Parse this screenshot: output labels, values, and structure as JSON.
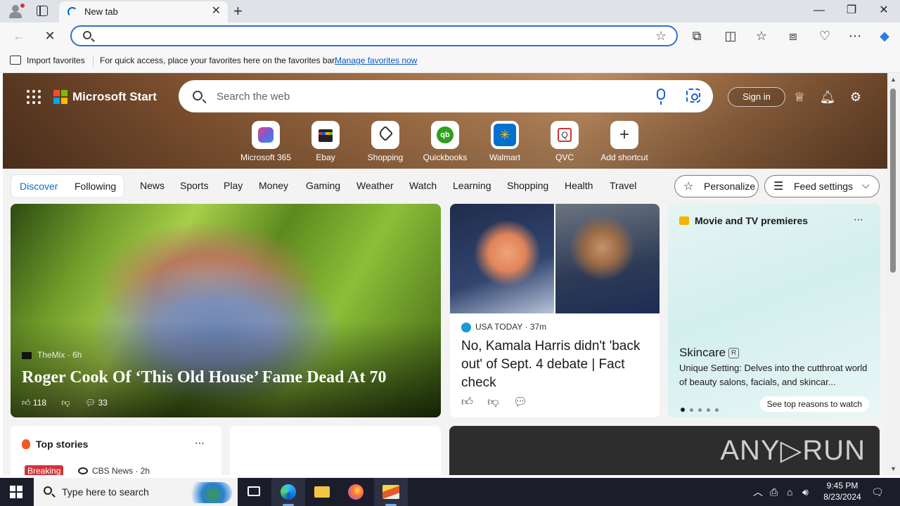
{
  "browser": {
    "tab_title": "New tab",
    "address_value": "",
    "favorites_bar": {
      "import_label": "Import favorites",
      "hint": "For quick access, place your favorites here on the favorites bar.",
      "manage_link": "Manage favorites now"
    }
  },
  "start": {
    "brand": "Microsoft Start",
    "search_placeholder": "Search the web",
    "sign_in": "Sign in",
    "shortcuts": [
      {
        "label": "Microsoft 365",
        "icon": "microsoft365-icon"
      },
      {
        "label": "Ebay",
        "icon": "ebay-icon"
      },
      {
        "label": "Shopping",
        "icon": "tag-icon"
      },
      {
        "label": "Quickbooks",
        "icon": "quickbooks-icon"
      },
      {
        "label": "Walmart",
        "icon": "walmart-icon"
      },
      {
        "label": "QVC",
        "icon": "qvc-icon"
      },
      {
        "label": "Add shortcut",
        "icon": "plus-icon"
      }
    ],
    "feed_nav": {
      "discover": "Discover",
      "following": "Following",
      "categories": [
        "News",
        "Sports",
        "Play",
        "Money",
        "Gaming",
        "Weather",
        "Watch",
        "Learning",
        "Shopping",
        "Health",
        "Travel"
      ],
      "personalize": "Personalize",
      "feed_settings": "Feed settings"
    },
    "lead_story": {
      "source": "TheMix",
      "age": "6h",
      "headline": "Roger Cook Of ‘This Old House’ Fame Dead At 70",
      "likes": "118",
      "comments": "33"
    },
    "story2": {
      "source": "USA TODAY",
      "age": "37m",
      "headline": "No, Kamala Harris didn't 'back out' of Sept. 4 debate | Fact check"
    },
    "premieres": {
      "heading": "Movie and TV premieres",
      "title": "Skincare",
      "rating": "R",
      "description": "Unique Setting: Delves into the cutthroat world of beauty salons, facials, and skincar...",
      "cta": "See top reasons to watch"
    },
    "top_stories": {
      "heading": "Top stories",
      "badge": "Breaking",
      "source": "CBS News",
      "age": "2h"
    },
    "watermark": "ANY▷RUN"
  },
  "taskbar": {
    "search_placeholder": "Type here to search",
    "time": "9:45 PM",
    "date": "8/23/2024"
  },
  "colors": {
    "accent": "#0f6cbd",
    "address_focus": "#2e6fd8",
    "breaking": "#d13438",
    "taskbar": "#1b1d2b"
  }
}
